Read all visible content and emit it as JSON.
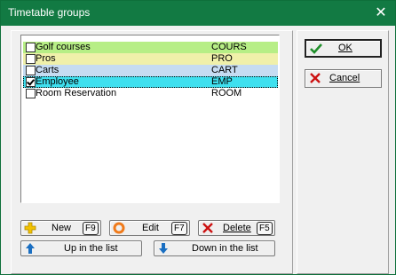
{
  "window": {
    "title": "Timetable groups"
  },
  "list": {
    "items": [
      {
        "name": "Golf courses",
        "code": "COURS",
        "checked": false,
        "bg": "#b7ee86",
        "selected": false
      },
      {
        "name": "Pros",
        "code": "PRO",
        "checked": false,
        "bg": "#f0f0aa",
        "selected": false
      },
      {
        "name": "Carts",
        "code": "CART",
        "checked": false,
        "bg": "#c6dcf2",
        "selected": false
      },
      {
        "name": "Employee",
        "code": "EMP",
        "checked": true,
        "bg": "#3fe0ef",
        "selected": true
      },
      {
        "name": "Room Reservation",
        "code": "ROOM",
        "checked": false,
        "bg": "#ffffff",
        "selected": false
      }
    ]
  },
  "buttons": {
    "new_label": "New",
    "new_key": "F9",
    "edit_label": "Edit",
    "edit_key": "F7",
    "delete_label": "Delete",
    "delete_key": "F5",
    "up_label": "Up in the list",
    "down_label": "Down in the list",
    "ok_label": "OK",
    "cancel_label": "Cancel"
  },
  "icons": {
    "close": "close-icon",
    "new": "plus-icon",
    "edit": "edit-icon",
    "delete": "delete-icon",
    "up": "arrow-up-icon",
    "down": "arrow-down-icon",
    "ok": "checkmark-icon",
    "cancel": "cancel-icon"
  },
  "colors": {
    "titlebar": "#127a43",
    "plus": "#f2c200",
    "edit_ring": "#f07a1a",
    "delete_x": "#cc1111",
    "arrow": "#1a6fc2",
    "ok_check": "#1f8f2a",
    "cancel_x": "#cc1111"
  }
}
